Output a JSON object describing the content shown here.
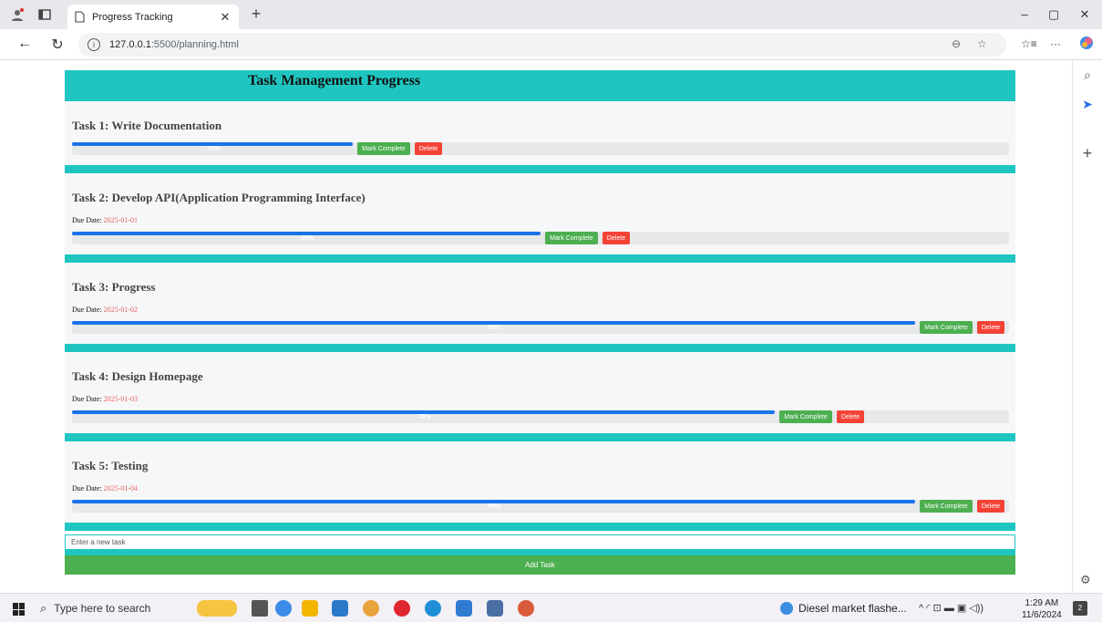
{
  "browser": {
    "tab_title": "Progress Tracking",
    "url_host": "127.0.0.1",
    "url_path": ":5500/planning.html"
  },
  "app": {
    "title": "Task Management Progress",
    "due_label": "Due Date:",
    "complete_label": "Mark Complete",
    "delete_label": "Delete",
    "tasks": [
      {
        "title": "Task 1: Write Documentation",
        "due": "",
        "progress": 30,
        "progress_label": "30%"
      },
      {
        "title": "Task 2: Develop API(Application Programming Interface)",
        "due": "2025-01-01",
        "progress": 50,
        "progress_label": "50%"
      },
      {
        "title": "Task 3: Progress",
        "due": "2025-01-02",
        "progress": 90,
        "progress_label": "90%"
      },
      {
        "title": "Task 4: Design Homepage",
        "due": "2025-01-03",
        "progress": 75,
        "progress_label": "75%"
      },
      {
        "title": "Task 5: Testing",
        "due": "2025-01-04",
        "progress": 90,
        "progress_label": "90%"
      }
    ],
    "new_task_placeholder": "Enter a new task",
    "add_task_label": "Add Task"
  },
  "taskbar": {
    "search_placeholder": "Type here to search",
    "news_text": "Diesel market flashe...",
    "time": "1:29 AM",
    "date": "11/6/2024",
    "notification_count": "2"
  }
}
